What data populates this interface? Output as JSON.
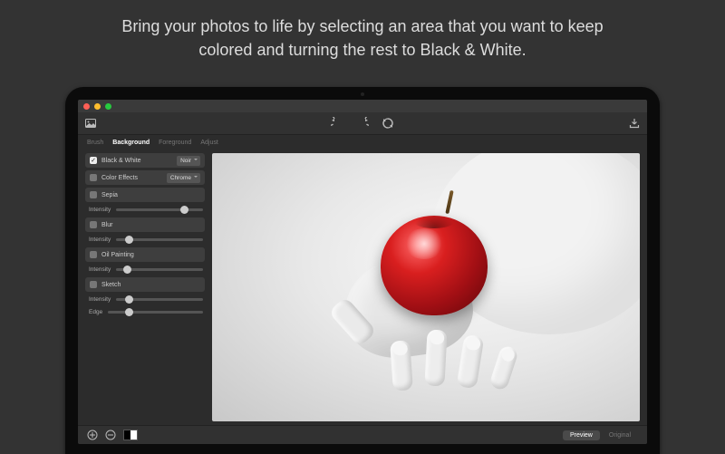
{
  "promo": {
    "line1": "Bring your photos to life by selecting an area that you want to keep",
    "line2": "colored and turning the rest to Black & White."
  },
  "tabs": [
    "Brush",
    "Background",
    "Foreground",
    "Adjust"
  ],
  "tabs_active_index": 1,
  "effects": {
    "bw": {
      "label": "Black & White",
      "checked": true,
      "select": "Noir"
    },
    "color": {
      "label": "Color Effects",
      "checked": false,
      "select": "Chrome"
    },
    "sepia": {
      "label": "Sepia",
      "checked": false
    },
    "blur": {
      "label": "Blur",
      "checked": false
    },
    "oil": {
      "label": "Oil Painting",
      "checked": false
    },
    "sketch": {
      "label": "Sketch",
      "checked": false
    }
  },
  "sliders": {
    "intensity_label": "Intensity",
    "edge_label": "Edge",
    "sepia_intensity": 0.78,
    "blur_intensity": 0.14,
    "oil_intensity": 0.12,
    "sketch_intensity": 0.14,
    "sketch_edge": 0.22
  },
  "footer": {
    "preview": "Preview",
    "original": "Original"
  }
}
